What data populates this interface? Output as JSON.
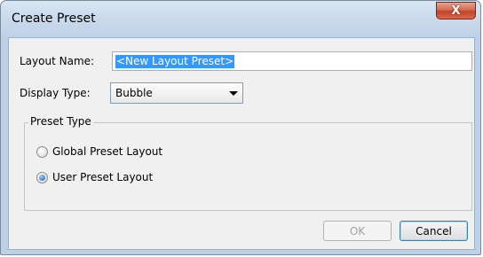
{
  "window": {
    "title": "Create Preset",
    "close_label": "X"
  },
  "form": {
    "layout_name_label": "Layout Name:",
    "layout_name_value": "<New Layout Preset>",
    "display_type_label": "Display Type:",
    "display_type_value": "Bubble"
  },
  "preset_type": {
    "legend": "Preset Type",
    "options": [
      {
        "label": "Global Preset Layout",
        "checked": false
      },
      {
        "label": "User Preset Layout",
        "checked": true
      }
    ]
  },
  "buttons": {
    "ok": "OK",
    "cancel": "Cancel"
  }
}
